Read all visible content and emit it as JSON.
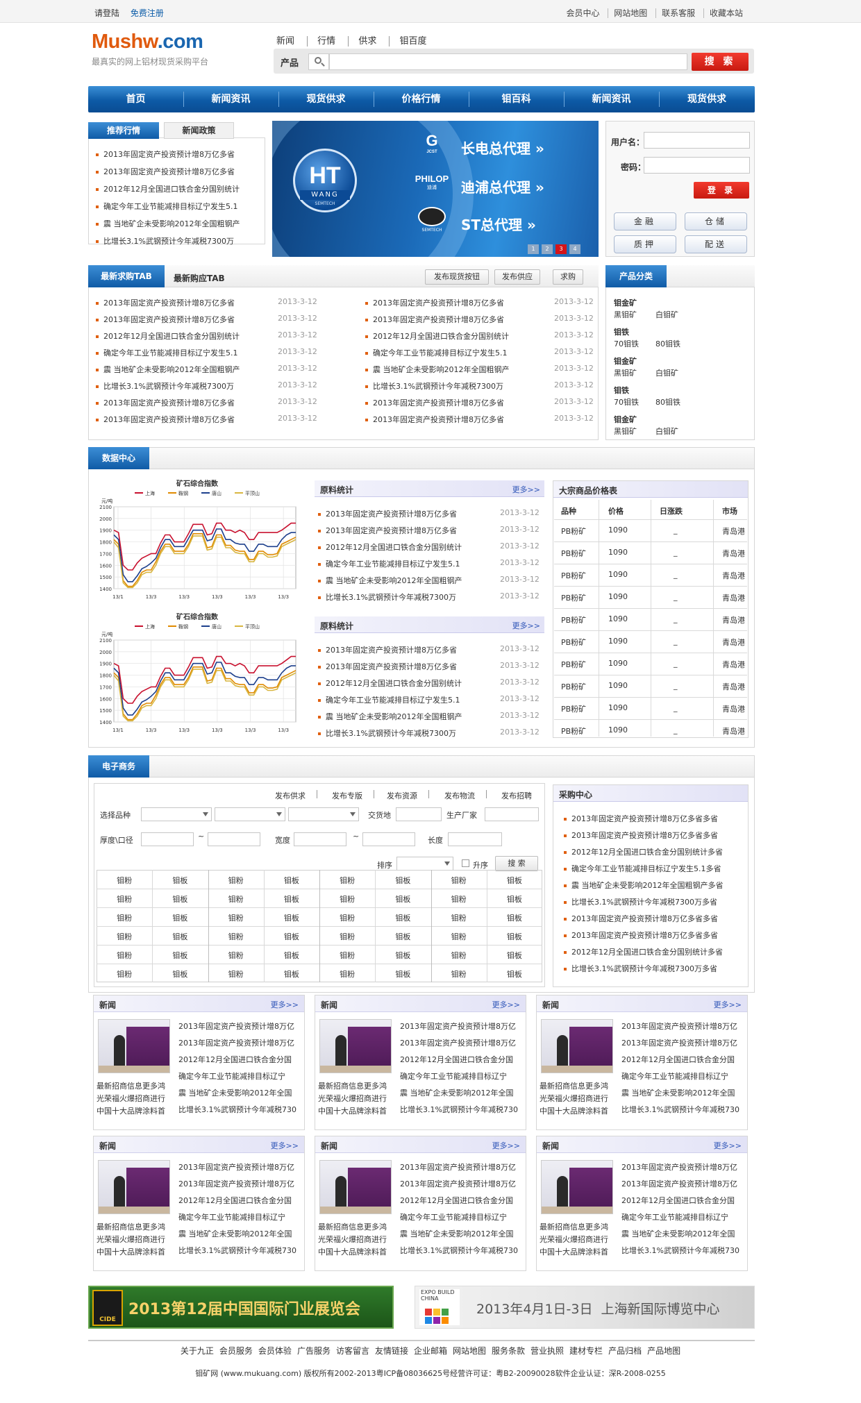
{
  "topbar": {
    "login": "请登陆",
    "register": "免费注册",
    "links": [
      "会员中心",
      "网站地图",
      "联系客服",
      "收藏本站"
    ]
  },
  "header": {
    "logo_main": "Mushw",
    "logo_suffix": ".com",
    "slogan": "最真实的网上铝材现货采购平台",
    "nav": [
      "新闻",
      "行情",
      "供求",
      "钼百度"
    ],
    "search_category": "产品",
    "search_placeholder": "",
    "search_button": "搜 索"
  },
  "mainnav": [
    "首页",
    "新闻资讯",
    "现货供求",
    "价格行情",
    "钼百科",
    "新闻资讯",
    "现货供求"
  ],
  "recommend": {
    "tab_active": "推荐行情",
    "tab_inactive": "新闻政策",
    "items": [
      "2013年固定资产投资预计增8万亿多省",
      "2013年固定资产投资预计增8万亿多省",
      "2012年12月全国进口铁合金分国别统计",
      "确定今年工业节能减排目标辽宁发生5.1",
      "震 当地矿企未受影响2012年全国粗钢产",
      "比增长3.1%武钢预计今年减税7300万"
    ]
  },
  "banner": {
    "brand_big": "HT",
    "brand_small": "WANG",
    "brand_tiny": "SEMTECH",
    "agents": [
      "长电总代理",
      "迪浦总代理",
      "ST总代理"
    ],
    "logos": [
      "JCST",
      "PHILOP",
      "SEMTECH"
    ],
    "logo_sub": [
      "",
      "迪浦",
      ""
    ],
    "pages": [
      "1",
      "2",
      "3",
      "4"
    ],
    "active_page": 3
  },
  "login": {
    "username_label": "用户名：",
    "password_label": "密码：",
    "username_value": "",
    "password_value": "",
    "submit": "登 录",
    "services": [
      "金融",
      "仓储",
      "质押",
      "配送"
    ]
  },
  "purchase": {
    "tab_active": "最新求购TAB",
    "tab_inactive": "最新购应TAB",
    "buttons": [
      "发布现货按钮",
      "发布供应",
      "求购"
    ],
    "left": [
      {
        "t": "2013年固定资产投资预计增8万亿多省",
        "d": "2013-3-12"
      },
      {
        "t": "2013年固定资产投资预计增8万亿多省",
        "d": "2013-3-12"
      },
      {
        "t": "2012年12月全国进口铁合金分国别统计",
        "d": "2013-3-12"
      },
      {
        "t": "确定今年工业节能减排目标辽宁发生5.1",
        "d": "2013-3-12"
      },
      {
        "t": "震 当地矿企未受影响2012年全国粗钢产",
        "d": "2013-3-12"
      },
      {
        "t": "比增长3.1%武钢预计今年减税7300万",
        "d": "2013-3-12"
      },
      {
        "t": "2013年固定资产投资预计增8万亿多省",
        "d": "2013-3-12"
      },
      {
        "t": "2013年固定资产投资预计增8万亿多省",
        "d": "2013-3-12"
      }
    ],
    "right": [
      {
        "t": "2013年固定资产投资预计增8万亿多省",
        "d": "2013-3-12"
      },
      {
        "t": "2013年固定资产投资预计增8万亿多省",
        "d": "2013-3-12"
      },
      {
        "t": "2012年12月全国进口铁合金分国别统计",
        "d": "2013-3-12"
      },
      {
        "t": "确定今年工业节能减排目标辽宁发生5.1",
        "d": "2013-3-12"
      },
      {
        "t": "震 当地矿企未受影响2012年全国粗钢产",
        "d": "2013-3-12"
      },
      {
        "t": "比增长3.1%武钢预计今年减税7300万",
        "d": "2013-3-12"
      },
      {
        "t": "2013年固定资产投资预计增8万亿多省",
        "d": "2013-3-12"
      },
      {
        "t": "2013年固定资产投资预计增8万亿多省",
        "d": "2013-3-12"
      }
    ]
  },
  "categories": {
    "title": "产品分类",
    "groups": [
      {
        "name": "钼金矿",
        "items": [
          "黑钼矿",
          "白钼矿"
        ]
      },
      {
        "name": "钼铁",
        "items": [
          "70钼铁",
          "80钼铁"
        ]
      },
      {
        "name": "钼金矿",
        "items": [
          "黑钼矿",
          "白钼矿"
        ]
      },
      {
        "name": "钼铁",
        "items": [
          "70钼铁",
          "80钼铁"
        ]
      },
      {
        "name": "钼金矿",
        "items": [
          "黑钼矿",
          "白钼矿"
        ]
      }
    ]
  },
  "data_center": {
    "tab": "数据中心",
    "charts": [
      {
        "title": "矿石综合指数"
      },
      {
        "title": "矿石综合指数"
      }
    ],
    "stats": [
      {
        "title": "原料统计",
        "more": "更多>>",
        "items": [
          {
            "t": "2013年固定资产投资预计增8万亿多省",
            "d": "2013-3-12"
          },
          {
            "t": "2013年固定资产投资预计增8万亿多省",
            "d": "2013-3-12"
          },
          {
            "t": "2012年12月全国进口铁合金分国别统计",
            "d": "2013-3-12"
          },
          {
            "t": "确定今年工业节能减排目标辽宁发生5.1",
            "d": "2013-3-12"
          },
          {
            "t": "震 当地矿企未受影响2012年全国粗钢产",
            "d": "2013-3-12"
          },
          {
            "t": "比增长3.1%武钢预计今年减税7300万",
            "d": "2013-3-12"
          }
        ]
      },
      {
        "title": "原料统计",
        "more": "更多>>",
        "items": [
          {
            "t": "2013年固定资产投资预计增8万亿多省",
            "d": "2013-3-12"
          },
          {
            "t": "2013年固定资产投资预计增8万亿多省",
            "d": "2013-3-12"
          },
          {
            "t": "2012年12月全国进口铁合金分国别统计",
            "d": "2013-3-12"
          },
          {
            "t": "确定今年工业节能减排目标辽宁发生5.1",
            "d": "2013-3-12"
          },
          {
            "t": "震 当地矿企未受影响2012年全国粗钢产",
            "d": "2013-3-12"
          },
          {
            "t": "比增长3.1%武钢预计今年减税7300万",
            "d": "2013-3-12"
          }
        ]
      }
    ],
    "price_table": {
      "title": "大宗商品价格表",
      "headers": [
        "品种",
        "价格",
        "日涨跌",
        "市场"
      ],
      "rows": [
        [
          "PB粉矿",
          "1090",
          "_",
          "青岛港"
        ],
        [
          "PB粉矿",
          "1090",
          "_",
          "青岛港"
        ],
        [
          "PB粉矿",
          "1090",
          "_",
          "青岛港"
        ],
        [
          "PB粉矿",
          "1090",
          "_",
          "青岛港"
        ],
        [
          "PB粉矿",
          "1090",
          "_",
          "青岛港"
        ],
        [
          "PB粉矿",
          "1090",
          "_",
          "青岛港"
        ],
        [
          "PB粉矿",
          "1090",
          "_",
          "青岛港"
        ],
        [
          "PB粉矿",
          "1090",
          "_",
          "青岛港"
        ],
        [
          "PB粉矿",
          "1090",
          "_",
          "青岛港"
        ],
        [
          "PB粉矿",
          "1090",
          "_",
          "青岛港"
        ]
      ]
    }
  },
  "chart_data": [
    {
      "type": "line",
      "title": "矿石综合指数",
      "ylabel": "元/吨",
      "ylim": [
        1400,
        2100
      ],
      "yticks": [
        2100,
        2000,
        1900,
        1800,
        1700,
        1600,
        1500,
        1400
      ],
      "xticks": [
        "13/1",
        "13/3",
        "13/3",
        "13/3",
        "13/3",
        "13/3"
      ],
      "grid": true,
      "legend_position": "top",
      "series": [
        {
          "name": "上海",
          "color": "#c8102e",
          "values": [
            1900,
            1880,
            1600,
            1560,
            1560,
            1620,
            1660,
            1680,
            1700,
            1700,
            1790,
            1860,
            1860,
            1800,
            1800,
            1800,
            1870,
            1950,
            1950,
            1950,
            1860,
            1870,
            1960,
            1960,
            1900,
            1900,
            1880,
            1900,
            1880,
            1820,
            1820,
            1880,
            1880,
            1880,
            1880,
            1880,
            1900,
            1930,
            1960,
            1960
          ]
        },
        {
          "name": "鞍钢",
          "color": "#e08a00",
          "values": [
            1820,
            1780,
            1470,
            1420,
            1420,
            1470,
            1540,
            1560,
            1560,
            1630,
            1720,
            1780,
            1780,
            1720,
            1720,
            1720,
            1780,
            1870,
            1870,
            1870,
            1750,
            1760,
            1860,
            1860,
            1770,
            1770,
            1730,
            1720,
            1720,
            1650,
            1650,
            1720,
            1720,
            1690,
            1690,
            1700,
            1780,
            1800,
            1820,
            1840
          ]
        },
        {
          "name": "唐山",
          "color": "#1c3f8c",
          "values": [
            1860,
            1820,
            1520,
            1460,
            1460,
            1510,
            1570,
            1590,
            1620,
            1660,
            1750,
            1820,
            1820,
            1760,
            1760,
            1760,
            1830,
            1900,
            1900,
            1900,
            1810,
            1820,
            1910,
            1910,
            1820,
            1820,
            1790,
            1780,
            1780,
            1720,
            1720,
            1780,
            1780,
            1760,
            1760,
            1760,
            1820,
            1860,
            1880,
            1880
          ]
        },
        {
          "name": "平顶山",
          "color": "#d8b640",
          "values": [
            1800,
            1750,
            1450,
            1410,
            1410,
            1450,
            1520,
            1540,
            1540,
            1600,
            1700,
            1760,
            1760,
            1700,
            1700,
            1700,
            1760,
            1850,
            1850,
            1850,
            1730,
            1740,
            1840,
            1840,
            1750,
            1750,
            1710,
            1700,
            1700,
            1630,
            1630,
            1700,
            1700,
            1670,
            1670,
            1680,
            1760,
            1780,
            1800,
            1820
          ]
        }
      ]
    },
    {
      "type": "line",
      "title": "矿石综合指数",
      "ylabel": "元/吨",
      "ylim": [
        1400,
        2100
      ],
      "yticks": [
        2100,
        2000,
        1900,
        1800,
        1700,
        1600,
        1500,
        1400
      ],
      "xticks": [
        "13/1",
        "13/3",
        "13/3",
        "13/3",
        "13/3",
        "13/3"
      ],
      "grid": true,
      "legend_position": "top",
      "series": [
        {
          "name": "上海",
          "color": "#c8102e",
          "values": [
            1900,
            1880,
            1600,
            1560,
            1560,
            1620,
            1660,
            1680,
            1700,
            1700,
            1790,
            1860,
            1860,
            1800,
            1800,
            1800,
            1870,
            1950,
            1950,
            1950,
            1860,
            1870,
            1960,
            1960,
            1900,
            1900,
            1880,
            1900,
            1880,
            1820,
            1820,
            1880,
            1880,
            1880,
            1880,
            1880,
            1900,
            1930,
            1960,
            1960
          ]
        },
        {
          "name": "鞍钢",
          "color": "#e08a00",
          "values": [
            1820,
            1780,
            1470,
            1420,
            1420,
            1470,
            1540,
            1560,
            1560,
            1630,
            1720,
            1780,
            1780,
            1720,
            1720,
            1720,
            1780,
            1870,
            1870,
            1870,
            1750,
            1760,
            1860,
            1860,
            1770,
            1770,
            1730,
            1720,
            1720,
            1650,
            1650,
            1720,
            1720,
            1690,
            1690,
            1700,
            1780,
            1800,
            1820,
            1840
          ]
        },
        {
          "name": "唐山",
          "color": "#1c3f8c",
          "values": [
            1860,
            1820,
            1520,
            1460,
            1460,
            1510,
            1570,
            1590,
            1620,
            1660,
            1750,
            1820,
            1820,
            1760,
            1760,
            1760,
            1830,
            1900,
            1900,
            1900,
            1810,
            1820,
            1910,
            1910,
            1820,
            1820,
            1790,
            1780,
            1780,
            1720,
            1720,
            1780,
            1780,
            1760,
            1760,
            1760,
            1820,
            1860,
            1880,
            1880
          ]
        },
        {
          "name": "平顶山",
          "color": "#d8b640",
          "values": [
            1800,
            1750,
            1450,
            1410,
            1410,
            1450,
            1520,
            1540,
            1540,
            1600,
            1700,
            1760,
            1760,
            1700,
            1700,
            1700,
            1760,
            1850,
            1850,
            1850,
            1730,
            1740,
            1840,
            1840,
            1750,
            1750,
            1710,
            1700,
            1700,
            1630,
            1630,
            1700,
            1700,
            1670,
            1670,
            1680,
            1760,
            1780,
            1800,
            1820
          ]
        }
      ]
    }
  ],
  "commerce": {
    "tab": "电子商务",
    "links": [
      "发布供求",
      "发布专版",
      "发布资源",
      "发布物流",
      "发布招聘"
    ],
    "fields": {
      "variety": "选择品种",
      "delivery": "交货地",
      "maker": "生产厂家",
      "thickness": "厚度\\口径",
      "tilde": "~",
      "width": "宽度",
      "length": "长度",
      "sort": "排序",
      "asc": "升序",
      "search": "搜 索"
    },
    "grid": [
      [
        "钼粉",
        "钼板",
        "钼粉",
        "钼板",
        "钼粉",
        "钼板",
        "钼粉",
        "钼板"
      ],
      [
        "钼粉",
        "钼板",
        "钼粉",
        "钼板",
        "钼粉",
        "钼板",
        "钼粉",
        "钼板"
      ],
      [
        "钼粉",
        "钼板",
        "钼粉",
        "钼板",
        "钼粉",
        "钼板",
        "钼粉",
        "钼板"
      ],
      [
        "钼粉",
        "钼板",
        "钼粉",
        "钼板",
        "钼粉",
        "钼板",
        "钼粉",
        "钼板"
      ],
      [
        "钼粉",
        "钼板",
        "钼粉",
        "钼板",
        "钼粉",
        "钼板",
        "钼粉",
        "钼板"
      ],
      [
        "钼粉",
        "钼板",
        "钼粉",
        "钼板",
        "钼粉",
        "钼板",
        "钼粉",
        "钼板"
      ]
    ],
    "procure": {
      "title": "采购中心",
      "items": [
        "2013年固定资产投资预计增8万亿多省多省",
        "2013年固定资产投资预计增8万亿多省多省",
        "2012年12月全国进口铁合金分国别统计多省",
        "确定今年工业节能减排目标辽宁发生5.1多省",
        "震 当地矿企未受影响2012年全国粗钢产多省",
        "比增长3.1%武钢预计今年减税7300万多省",
        "2013年固定资产投资预计增8万亿多省多省",
        "2013年固定资产投资预计增8万亿多省多省",
        "2012年12月全国进口铁合金分国别统计多省",
        "比增长3.1%武钢预计今年减税7300万多省"
      ]
    }
  },
  "news_boxes": {
    "title": "新闻",
    "more": "更多>>",
    "captions": [
      "最新招商信息更多鸿",
      "光荣福火爆招商进行",
      "中国十大品牌涂料首"
    ],
    "lines": [
      "2013年固定资产投资预计增8万亿",
      "2013年固定资产投资预计增8万亿",
      "2012年12月全国进口铁合金分国",
      "确定今年工业节能减排目标辽宁",
      "震 当地矿企未受影响2012年全国",
      "比增长3.1%武钢预计今年减税730"
    ]
  },
  "ads": {
    "left": "2013第12届中国国际门业展览会",
    "left_logo": "CIDE",
    "right_logo_top": "EXPO BUILD",
    "right_logo_bottom": "CHINA",
    "right": "2013年4月1日-3日  上海新国际博览中心"
  },
  "footer": {
    "links": [
      "关于九正",
      "会员服务",
      "会员体验",
      "广告服务",
      "访客留言",
      "友情链接",
      "企业邮箱",
      "网站地图",
      "服务条款",
      "营业执照",
      "建材专栏",
      "产品归档",
      "产品地图"
    ],
    "copyright": "钼矿网 (www.mukuang.com) 版权所有2002-2013粤ICP备08036625号经营许可证：粤B2-20090028软件企业认证：深R-2008-0255"
  },
  "colors": {
    "brand_blue": "#0f5ba6",
    "accent_orange": "#e05a0e",
    "button_red": "#d8201a"
  }
}
